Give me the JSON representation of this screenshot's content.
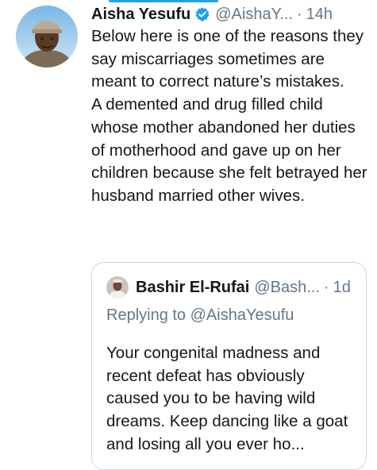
{
  "tweet": {
    "author_name": "Aisha Yesufu",
    "handle": "@AishaY...",
    "separator": "·",
    "time": "14h",
    "verified": true,
    "text_lines": [
      "Below here is one of the reasons they say miscarriages sometimes are meant to correct nature’s mistakes.",
      "A demented and drug filled child whose mother abandoned her duties of motherhood and gave up on her children because she felt betrayed her husband married other wives."
    ]
  },
  "quoted_tweet": {
    "author_name": "Bashir El-Rufai",
    "handle": "@Bash...",
    "separator": "·",
    "time": "1d",
    "replying_to": "Replying to @AishaYesufu",
    "text": "Your congenital madness and recent defeat has obviously caused you to be having wild dreams. Keep dancing like a goat and losing all you ever ho..."
  },
  "colors": {
    "accent": "#1da1f2",
    "text_primary": "#14171a",
    "text_secondary": "#657786",
    "border": "#ccd6dd"
  },
  "icons": {
    "verified": "verified-badge-icon"
  }
}
